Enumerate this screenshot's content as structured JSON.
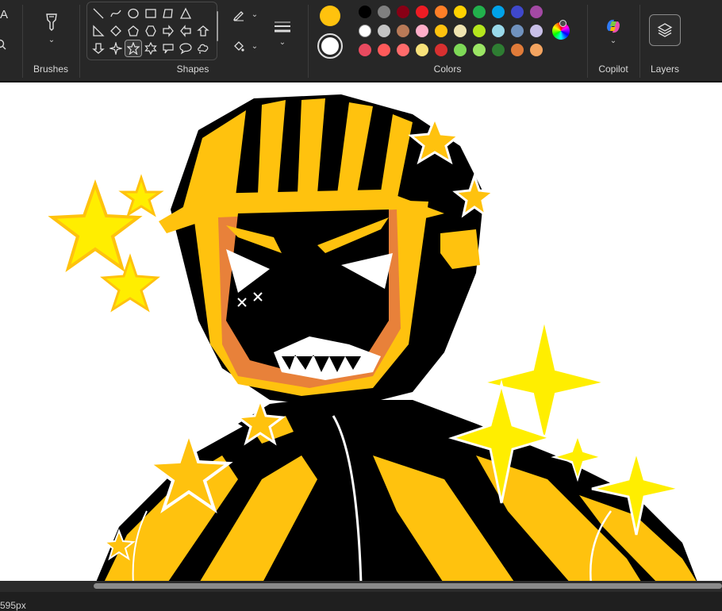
{
  "ribbon": {
    "partial_tool_glyph": "A",
    "brushes_label": "Brushes",
    "shapes_label": "Shapes",
    "colors_label": "Colors",
    "copilot_label": "Copilot",
    "layers_label": "Layers"
  },
  "shapes": [
    "line-shape-icon",
    "curve-shape-icon",
    "oval-shape-icon",
    "rectangle-shape-icon",
    "polygon-shape-icon",
    "triangle-shape-icon",
    "right-triangle-shape-icon",
    "diamond-shape-icon",
    "pentagon-shape-icon",
    "hexagon-shape-icon",
    "right-arrow-shape-icon",
    "left-arrow-shape-icon",
    "up-arrow-shape-icon",
    "down-arrow-shape-icon",
    "four-point-star-shape-icon",
    "five-point-star-shape-icon",
    "six-point-star-shape-icon",
    "rect-callout-shape-icon",
    "oval-callout-shape-icon",
    "cloud-callout-shape-icon"
  ],
  "selected_shape": "five-point-star-shape-icon",
  "colors": {
    "primary": "#ffc20e",
    "secondary": "#ffffff",
    "palette": [
      [
        "#000000",
        "#7f7f7f",
        "#880015",
        "#ed1c24",
        "#ff7f27",
        "#ffd200",
        "#22b14c",
        "#00a2e8",
        "#3f48cc",
        "#a349a4"
      ],
      [
        "#ffffff",
        "#c3c3c3",
        "#b97a57",
        "#ffaec9",
        "#ffc20e",
        "#efe4b0",
        "#b5e61d",
        "#99d9ea",
        "#7092be",
        "#c8bfe7"
      ],
      [
        "#e84a5f",
        "#ff5a5a",
        "#ff6b6b",
        "#f8e27a",
        "#d83030",
        "#7ed957",
        "#9be564",
        "#2e7d32",
        "#e07b39",
        "#f4a460"
      ]
    ]
  },
  "canvas": {
    "accent_yellow": "#ffc20e",
    "star_yellow": "#ffee00",
    "orange_pattern": "#e8813a"
  },
  "status": {
    "size_text": "595px"
  }
}
